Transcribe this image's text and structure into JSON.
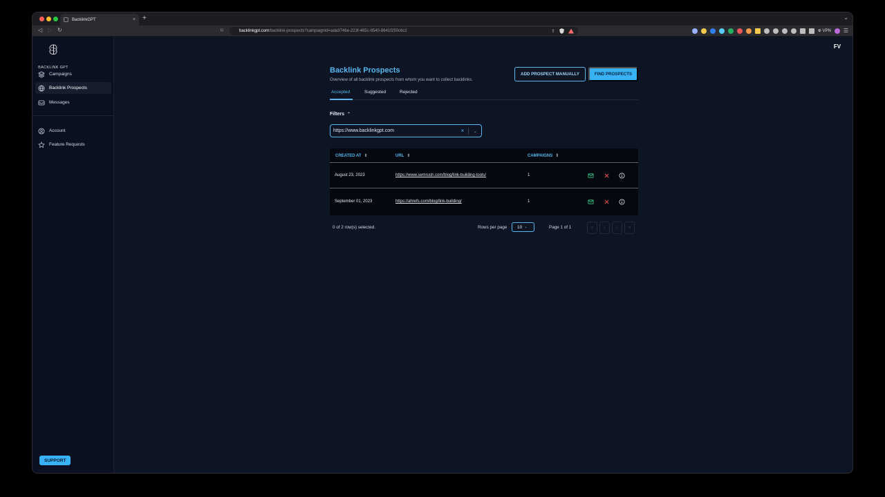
{
  "browser": {
    "tab_title": "BacklinkGPT",
    "tab_close": "×",
    "new_tab": "+",
    "url_domain": "backlinkgpt.com",
    "url_path": "/backlink-prospects?campaignId=ada3746e-223f-465c-9540-8641f250c6c2",
    "vpn_label": "⊕ VPN"
  },
  "sidebar": {
    "logo_text": "BACKLINK GPT",
    "items": [
      {
        "label": "Campaigns",
        "icon": "layers-icon"
      },
      {
        "label": "Backlink Prospects",
        "icon": "globe-icon"
      },
      {
        "label": "Messages",
        "icon": "inbox-icon"
      },
      {
        "label": "Account",
        "icon": "user-circle-icon"
      },
      {
        "label": "Feature Requests",
        "icon": "star-icon"
      }
    ],
    "support_label": "SUPPORT"
  },
  "header": {
    "avatar_initials": "FV"
  },
  "page": {
    "title": "Backlink Prospects",
    "subtitle": "Overview of all backlink prospects from whom you want to collect backlinks.",
    "add_button": "ADD PROSPECT MANUALLY",
    "find_button": "FIND PROSPECTS",
    "tabs": [
      {
        "label": "Accepted"
      },
      {
        "label": "Suggested"
      },
      {
        "label": "Rejected"
      }
    ],
    "active_tab": "Accepted",
    "filters_label": "Filters",
    "filter_value": "https://www.backlinkgpt.com",
    "filter_clear": "×"
  },
  "table": {
    "columns": [
      {
        "label": "CREATED AT"
      },
      {
        "label": "URL"
      },
      {
        "label": "CAMPAIGNS"
      }
    ],
    "rows": [
      {
        "created_at": "August 23, 2023",
        "url": "https://www.semrush.com/blog/link-building-tools/",
        "campaigns": "1"
      },
      {
        "created_at": "September 01, 2023",
        "url": "https://ahrefs.com/blog/link-building/",
        "campaigns": "1"
      }
    ]
  },
  "pagination": {
    "selected_text": "0 of 2 row(s) selected.",
    "rows_per_page_label": "Rows per page",
    "rows_per_page_value": "10",
    "page_label": "Page 1 of 1"
  },
  "colors": {
    "accent": "#38b2f5",
    "background": "#0d1424",
    "sidebar": "#0a1020",
    "accept_green": "#3ecf8e",
    "reject_red": "#f05252"
  }
}
